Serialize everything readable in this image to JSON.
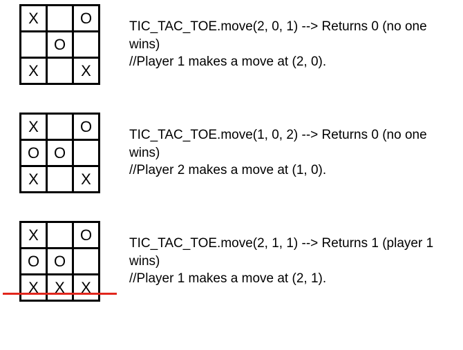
{
  "steps": [
    {
      "board": [
        [
          "X",
          "",
          "O"
        ],
        [
          "",
          "O",
          ""
        ],
        [
          "X",
          "",
          "X"
        ]
      ],
      "code": "TIC_TAC_TOE.move(2, 0, 1) --> Returns 0 (no one wins)",
      "comment": "//Player 1 makes a move at (2, 0).",
      "win_row": null
    },
    {
      "board": [
        [
          "X",
          "",
          "O"
        ],
        [
          "O",
          "O",
          ""
        ],
        [
          "X",
          "",
          "X"
        ]
      ],
      "code": "TIC_TAC_TOE.move(1, 0, 2) --> Returns 0 (no one wins)",
      "comment": "//Player 2 makes a move at (1, 0).",
      "win_row": null
    },
    {
      "board": [
        [
          "X",
          "",
          "O"
        ],
        [
          "O",
          "O",
          ""
        ],
        [
          "X",
          "X",
          "X"
        ]
      ],
      "code": "TIC_TAC_TOE.move(2, 1, 1) --> Returns 1 (player 1 wins)",
      "comment": "//Player 1 makes a move at (2, 1).",
      "win_row": 2
    }
  ]
}
